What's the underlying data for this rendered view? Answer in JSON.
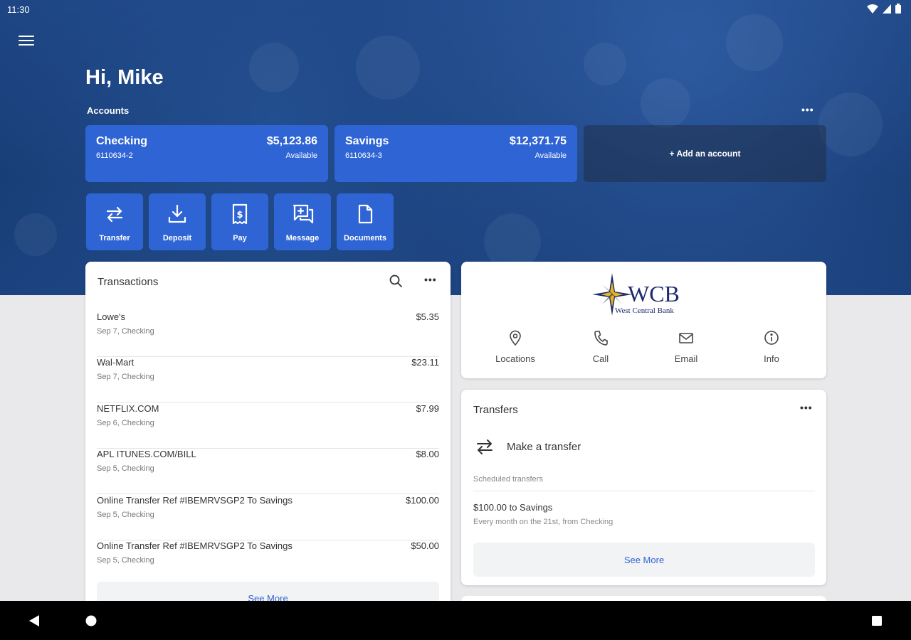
{
  "status_bar": {
    "time": "11:30",
    "icons": [
      "wifi-icon",
      "signal-icon",
      "battery-icon"
    ]
  },
  "header": {
    "greeting": "Hi, Mike",
    "accounts_label": "Accounts",
    "more_label": "•••"
  },
  "accounts": [
    {
      "name": "Checking",
      "number": "6110634-2",
      "balance": "$5,123.86",
      "balance_label": "Available"
    },
    {
      "name": "Savings",
      "number": "6110634-3",
      "balance": "$12,371.75",
      "balance_label": "Available"
    }
  ],
  "add_account_label": "+ Add an account",
  "quick_actions": [
    {
      "label": "Transfer",
      "icon": "transfer-icon"
    },
    {
      "label": "Deposit",
      "icon": "deposit-icon"
    },
    {
      "label": "Pay",
      "icon": "pay-icon"
    },
    {
      "label": "Message",
      "icon": "message-icon"
    },
    {
      "label": "Documents",
      "icon": "documents-icon"
    }
  ],
  "transactions": {
    "title": "Transactions",
    "more_label": "•••",
    "items": [
      {
        "desc": "Lowe's",
        "amount": "$5.35",
        "sub": "Sep 7, Checking"
      },
      {
        "desc": "Wal-Mart",
        "amount": "$23.11",
        "sub": "Sep 7, Checking"
      },
      {
        "desc": "NETFLIX.COM",
        "amount": "$7.99",
        "sub": "Sep 6, Checking"
      },
      {
        "desc": "APL ITUNES.COM/BILL",
        "amount": "$8.00",
        "sub": "Sep 5, Checking"
      },
      {
        "desc": "Online Transfer Ref #IBEMRVSGP2 To Savings",
        "amount": "$100.00",
        "sub": "Sep 5, Checking"
      },
      {
        "desc": "Online Transfer Ref #IBEMRVSGP2 To Savings",
        "amount": "$50.00",
        "sub": "Sep 5, Checking"
      }
    ],
    "see_more": "See More"
  },
  "bank": {
    "logo_text": "WCB",
    "logo_subtext": "West Central Bank",
    "contacts": [
      {
        "label": "Locations",
        "icon": "location-pin-icon"
      },
      {
        "label": "Call",
        "icon": "phone-icon"
      },
      {
        "label": "Email",
        "icon": "email-icon"
      },
      {
        "label": "Info",
        "icon": "info-icon"
      }
    ]
  },
  "transfers": {
    "title": "Transfers",
    "more_label": "•••",
    "make_transfer": "Make a transfer",
    "scheduled_label": "Scheduled transfers",
    "scheduled": [
      {
        "title": "$100.00 to Savings",
        "detail": "Every month on the 21st, from Checking"
      }
    ],
    "see_more": "See More"
  },
  "colors": {
    "accent": "#2f64d5",
    "hero": "#1a427e",
    "navbar": "#000000"
  }
}
